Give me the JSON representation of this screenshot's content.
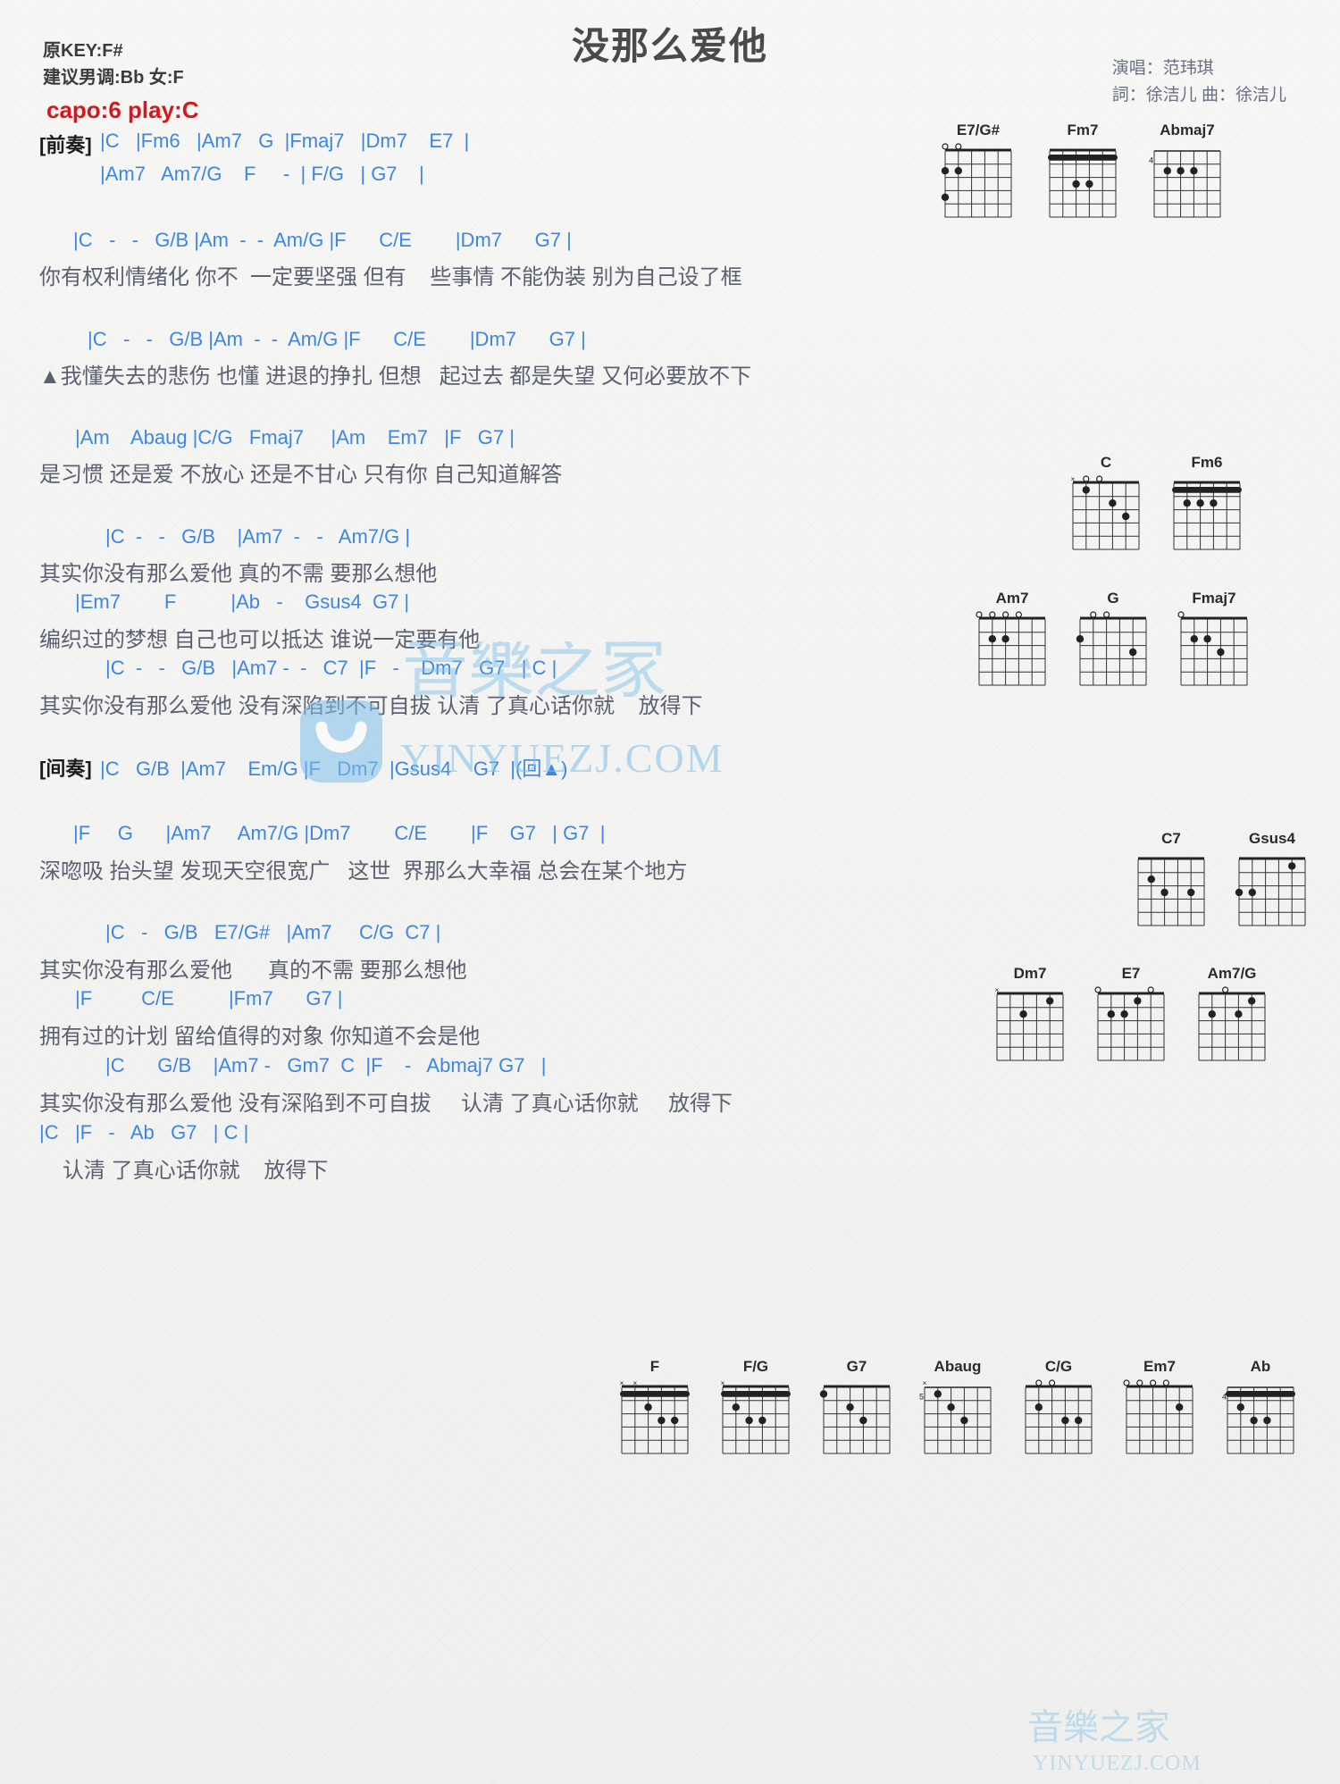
{
  "header": {
    "title": "没那么爱他",
    "orig_key": "原KEY:F#",
    "suggest_key": "建议男调:Bb 女:F",
    "capo": "capo:6 play:C",
    "singer": "演唱：范玮琪",
    "writers": "詞：徐洁儿  曲：徐洁儿"
  },
  "colors": {
    "chord": "#3d86e8",
    "lyric": "#5c6070",
    "capo": "#d8161d",
    "title": "#4a4a4a",
    "watermark": "#7cc0ea"
  },
  "watermark": {
    "text": "YINYUEZJ.COM",
    "logo": "smile-face-logo"
  },
  "sections": [
    {
      "id": "intro-label",
      "text": "[前奏]"
    },
    {
      "id": "intro-1",
      "text": "|C   |Fm6   |Am7   G  |Fmaj7   |Dm7    E7  |"
    },
    {
      "id": "intro-2",
      "text": "|Am7   Am7/G    F     -  | F/G   | G7    |"
    },
    {
      "id": "v1-chords",
      "text": "|C   -   -   G/B |Am  -  -  Am/G |F      C/E        |Dm7      G7 |"
    },
    {
      "id": "v1-lyric",
      "text": "你有权利情绪化 你不  一定要坚强 但有    些事情 不能伪装 别为自己设了框"
    },
    {
      "id": "v2-chords",
      "text": "|C   -   -   G/B |Am  -  -  Am/G |F      C/E        |Dm7      G7 |"
    },
    {
      "id": "v2-lyric",
      "text": "▲我懂失去的悲伤 也懂 进退的挣扎 但想   起过去 都是失望 又何必要放不下"
    },
    {
      "id": "pc-chords",
      "text": "|Am    Abaug |C/G   Fmaj7     |Am    Em7   |F   G7 |"
    },
    {
      "id": "pc-lyric",
      "text": "是习惯 还是爱 不放心 还是不甘心 只有你 自己知道解答"
    },
    {
      "id": "ch1-chords",
      "text": "|C  -   -   G/B    |Am7  -   -   Am7/G |"
    },
    {
      "id": "ch1-lyric",
      "text": "其实你没有那么爱他 真的不需 要那么想他"
    },
    {
      "id": "ch2-chords",
      "text": "|Em7        F          |Ab   -    Gsus4  G7 |"
    },
    {
      "id": "ch2-lyric",
      "text": "编织过的梦想 自己也可以抵达 谁说一定要有他"
    },
    {
      "id": "ch3-chords",
      "text": "|C  -   -   G/B   |Am7 -  -   C7  |F   -    Dm7   G7   | C |"
    },
    {
      "id": "ch3-lyric",
      "text": "其实你没有那么爱他 没有深陷到不可自拔 认清 了真心话你就    放得下"
    },
    {
      "id": "interlude-label",
      "text": "[间奏]"
    },
    {
      "id": "interlude",
      "text": "|C   G/B  |Am7    Em/G |F   Dm7  |Gsus4    G7  |(回▲)"
    },
    {
      "id": "v3-chords",
      "text": "|F     G      |Am7     Am7/G |Dm7        C/E        |F    G7   | G7  |"
    },
    {
      "id": "v3-lyric",
      "text": "深唿吸 抬头望 发现天空很宽广   这世  界那么大幸福 总会在某个地方"
    },
    {
      "id": "ch4-chords",
      "text": "|C   -   G/B   E7/G#   |Am7     C/G  C7 |"
    },
    {
      "id": "ch4-lyric",
      "text": "其实你没有那么爱他      真的不需 要那么想他"
    },
    {
      "id": "ch5-chords",
      "text": "|F         C/E          |Fm7      G7 |"
    },
    {
      "id": "ch5-lyric",
      "text": "拥有过的计划 留给值得的对象 你知道不会是他"
    },
    {
      "id": "ch6-chords",
      "text": "|C      G/B    |Am7 -   Gm7  C  |F    -   Abmaj7 G7   |"
    },
    {
      "id": "ch6-lyric",
      "text": "其实你没有那么爱他 没有深陷到不可自拔     认清 了真心话你就     放得下"
    },
    {
      "id": "end-chords",
      "text": "|C   |F   -   Ab   G7   | C |"
    },
    {
      "id": "end-lyric",
      "text": "认清 了真心话你就    放得下"
    }
  ],
  "chord_diagrams_top": [
    {
      "name": "E7/G#",
      "base_fret": "",
      "start_label": "",
      "opens": [
        1,
        2
      ],
      "muted": [],
      "dots": [
        [
          2,
          1
        ],
        [
          2,
          2
        ],
        [
          4,
          1
        ]
      ],
      "barre": null
    },
    {
      "name": "Fm7",
      "base_fret": "",
      "start_label": "",
      "opens": [],
      "muted": [],
      "dots": [
        [
          3,
          3
        ],
        [
          3,
          4
        ]
      ],
      "barre": 1
    },
    {
      "name": "Abmaj7",
      "base_fret": "4",
      "start_label": "4",
      "opens": [],
      "muted": [],
      "dots": [
        [
          2,
          2
        ],
        [
          2,
          3
        ],
        [
          2,
          4
        ]
      ],
      "barre": null
    }
  ],
  "chord_diagrams_mid": [
    {
      "name": "C",
      "base_fret": "",
      "start_label": "",
      "opens": [
        2,
        3
      ],
      "muted": [
        1
      ],
      "dots": [
        [
          1,
          2
        ],
        [
          2,
          4
        ],
        [
          3,
          5
        ]
      ],
      "barre": null
    },
    {
      "name": "Fm6",
      "base_fret": "",
      "start_label": "",
      "opens": [],
      "muted": [],
      "dots": [
        [
          2,
          2
        ],
        [
          2,
          3
        ],
        [
          2,
          4
        ]
      ],
      "barre": 1
    },
    {
      "name": "Am7",
      "base_fret": "",
      "start_label": "",
      "opens": [
        1,
        2,
        3,
        4
      ],
      "muted": [],
      "dots": [
        [
          2,
          2
        ],
        [
          2,
          3
        ]
      ],
      "barre": null
    },
    {
      "name": "G",
      "base_fret": "",
      "start_label": "",
      "opens": [
        2,
        3
      ],
      "muted": [],
      "dots": [
        [
          2,
          1
        ],
        [
          3,
          5
        ]
      ],
      "barre": null
    },
    {
      "name": "Fmaj7",
      "base_fret": "",
      "start_label": "",
      "opens": [
        1
      ],
      "muted": [],
      "dots": [
        [
          2,
          3
        ],
        [
          3,
          4
        ],
        [
          2,
          2
        ]
      ],
      "barre": null
    }
  ],
  "chord_diagrams_right": [
    {
      "name": "C7",
      "base_fret": "",
      "start_label": "",
      "opens": [],
      "muted": [],
      "dots": [
        [
          2,
          2
        ],
        [
          3,
          3
        ],
        [
          3,
          5
        ]
      ],
      "barre": null
    },
    {
      "name": "Gsus4",
      "base_fret": "",
      "start_label": "",
      "opens": [],
      "muted": [],
      "dots": [
        [
          3,
          1
        ],
        [
          3,
          2
        ],
        [
          1,
          5
        ]
      ],
      "barre": null
    },
    {
      "name": "Dm7",
      "base_fret": "",
      "start_label": "",
      "opens": [],
      "muted": [
        1
      ],
      "dots": [
        [
          2,
          3
        ],
        [
          1,
          5
        ]
      ],
      "barre": null
    },
    {
      "name": "E7",
      "base_fret": "",
      "start_label": "",
      "opens": [
        1,
        5
      ],
      "muted": [],
      "dots": [
        [
          2,
          3
        ],
        [
          1,
          4
        ],
        [
          2,
          2
        ]
      ],
      "barre": null
    },
    {
      "name": "Am7/G",
      "base_fret": "",
      "start_label": "",
      "opens": [
        3
      ],
      "muted": [],
      "dots": [
        [
          2,
          2
        ],
        [
          2,
          4
        ],
        [
          1,
          5
        ]
      ],
      "barre": null
    }
  ],
  "chord_diagrams_bottom": [
    {
      "name": "F",
      "base_fret": "",
      "start_label": "",
      "opens": [],
      "muted": [
        1,
        2
      ],
      "dots": [
        [
          2,
          3
        ],
        [
          3,
          4
        ],
        [
          3,
          5
        ]
      ],
      "barre": 1
    },
    {
      "name": "F/G",
      "base_fret": "",
      "start_label": "",
      "opens": [],
      "muted": [
        1
      ],
      "dots": [
        [
          3,
          3
        ],
        [
          3,
          4
        ],
        [
          2,
          2
        ]
      ],
      "barre": 1
    },
    {
      "name": "G7",
      "base_fret": "",
      "start_label": "",
      "opens": [],
      "muted": [],
      "dots": [
        [
          1,
          1
        ],
        [
          2,
          3
        ],
        [
          3,
          4
        ]
      ],
      "barre": null
    },
    {
      "name": "Abaug",
      "base_fret": "5",
      "start_label": "5",
      "opens": [],
      "muted": [
        1
      ],
      "dots": [
        [
          1,
          2
        ],
        [
          2,
          3
        ],
        [
          3,
          4
        ]
      ],
      "barre": null
    },
    {
      "name": "C/G",
      "base_fret": "",
      "start_label": "",
      "opens": [
        2,
        3
      ],
      "muted": [],
      "dots": [
        [
          2,
          2
        ],
        [
          3,
          4
        ],
        [
          3,
          5
        ]
      ],
      "barre": null
    },
    {
      "name": "Em7",
      "base_fret": "",
      "start_label": "",
      "opens": [
        1,
        2,
        3,
        4
      ],
      "muted": [],
      "dots": [
        [
          2,
          5
        ]
      ],
      "barre": null
    },
    {
      "name": "Ab",
      "base_fret": "4",
      "start_label": "4",
      "opens": [],
      "muted": [],
      "dots": [
        [
          2,
          2
        ],
        [
          3,
          3
        ],
        [
          3,
          4
        ]
      ],
      "barre": 1
    }
  ]
}
